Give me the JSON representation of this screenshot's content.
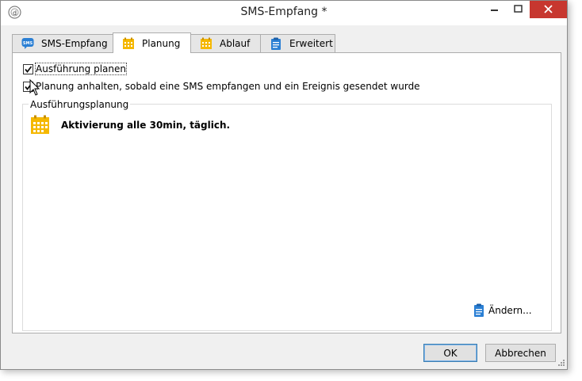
{
  "window": {
    "title": "SMS-Empfang *"
  },
  "tabs": [
    {
      "label": "SMS-Empfang",
      "icon": "sms-icon",
      "active": false
    },
    {
      "label": "Planung",
      "icon": "calendar-icon",
      "active": true
    },
    {
      "label": "Ablauf",
      "icon": "calendar-icon",
      "active": false
    },
    {
      "label": "Erweitert",
      "icon": "clipboard-icon",
      "active": false
    }
  ],
  "options": {
    "schedule_label": "Ausführung planen",
    "schedule_checked": true,
    "stop_label": "Planung anhalten, sobald eine SMS empfangen und ein Ereignis gesendet wurde",
    "stop_checked": true
  },
  "schedule_group": {
    "title": "Ausführungsplanung",
    "summary": "Aktivierung alle 30min, täglich.",
    "change_label": "Ändern..."
  },
  "buttons": {
    "ok": "OK",
    "cancel": "Abbrechen"
  },
  "colors": {
    "calendar_yellow": "#f5b800",
    "sms_blue": "#2a7fd4",
    "close_red": "#c7372f",
    "default_button_border": "#3c7fb1"
  }
}
